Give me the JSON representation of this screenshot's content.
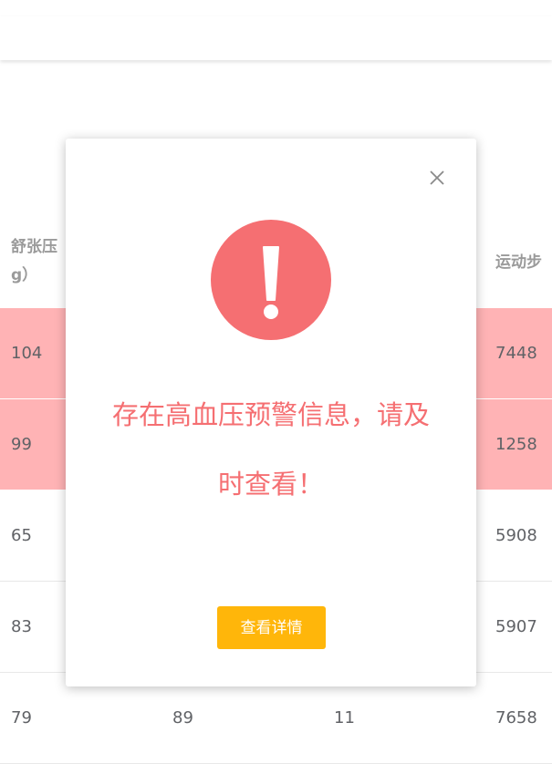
{
  "table": {
    "headers": [
      {
        "line1": "舒张压",
        "line2": "g）"
      },
      {
        "line1": "运动步",
        "line2": ""
      }
    ],
    "rows": [
      {
        "warn": true,
        "cells": [
          "104",
          "",
          "",
          "7448"
        ]
      },
      {
        "warn": true,
        "cells": [
          "99",
          "",
          "",
          "1258"
        ]
      },
      {
        "warn": false,
        "cells": [
          "65",
          "",
          "",
          "5908"
        ]
      },
      {
        "warn": false,
        "cells": [
          "83",
          "",
          "",
          "5907"
        ]
      },
      {
        "warn": false,
        "cells": [
          "79",
          "89",
          "11",
          "7658"
        ]
      }
    ]
  },
  "modal": {
    "icon": "exclamation-icon",
    "close_icon": "close-icon",
    "message_line1": "存在高血压预警信息，请及",
    "message_line2": "时查看！",
    "button_label": "查看详情"
  },
  "colors": {
    "warning_row": "#ffb3b5",
    "alert_red": "#f56f72",
    "button_yellow": "#ffb60a"
  }
}
